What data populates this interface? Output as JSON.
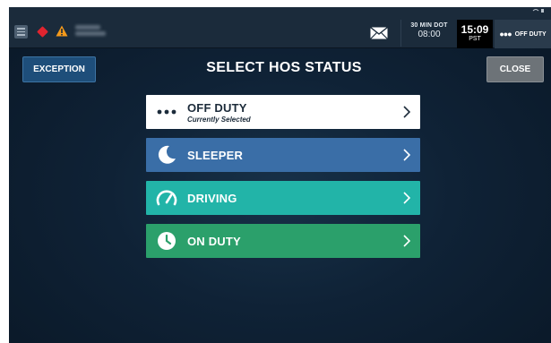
{
  "topbar": {
    "dot_clock_label": "30 MIN DOT",
    "dot_clock_value": "08:00",
    "time": "15:09",
    "timezone": "PST",
    "current_status": "OFF DUTY",
    "current_status_icon": "dots-icon"
  },
  "header": {
    "exception_label": "EXCEPTION",
    "title": "SELECT HOS STATUS",
    "close_label": "CLOSE"
  },
  "options": [
    {
      "name": "OFF DUTY",
      "sub": "Currently Selected",
      "icon": "dots-icon",
      "color": "#ffffff"
    },
    {
      "name": "SLEEPER",
      "icon": "moon-icon",
      "color": "#3a6ea7"
    },
    {
      "name": "DRIVING",
      "icon": "speedometer-icon",
      "color": "#22b4a8"
    },
    {
      "name": "ON DUTY",
      "icon": "clock-icon",
      "color": "#2ba06b"
    }
  ],
  "colors": {
    "background": "#0f2236",
    "topbar": "#1b2b3b",
    "exception_button": "#1e4e7a",
    "close_button": "#6d7378",
    "alert_red": "#e0242f",
    "warning_orange": "#f59a1b"
  }
}
